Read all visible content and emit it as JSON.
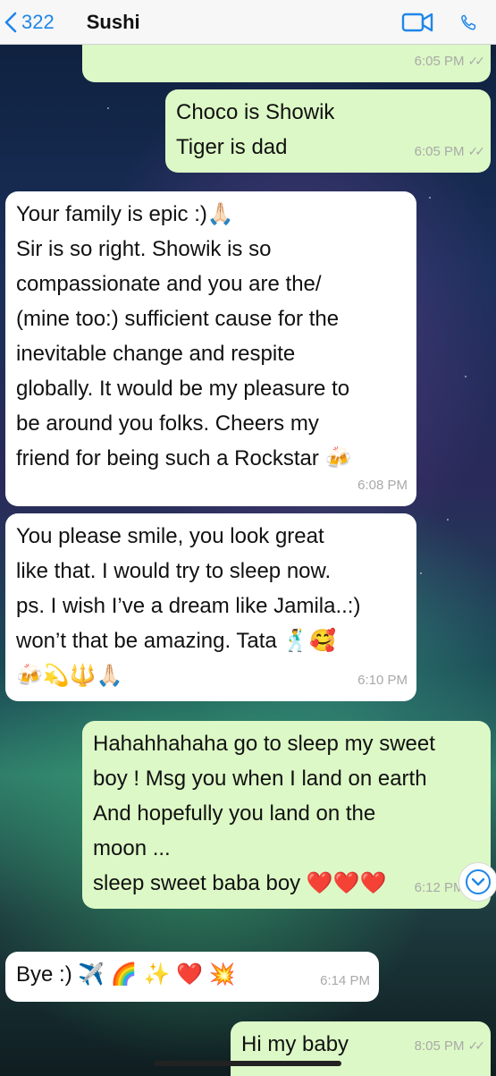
{
  "header": {
    "back_count": "322",
    "contact_name": "Sushi"
  },
  "messages": [
    {
      "dir": "out",
      "lines": [],
      "time": "6:05 PM"
    },
    {
      "dir": "out",
      "lines": [
        "Choco is Showik",
        "Tiger is dad"
      ],
      "time": "6:05 PM"
    },
    {
      "dir": "in",
      "lines": [
        "Your family is epic :)🙏🏻",
        "Sir is so right. Showik is so",
        "compassionate and you are the/",
        "(mine too:) sufficient cause for the",
        "inevitable change and respite",
        "globally. It would be my pleasure to",
        "be around you folks. Cheers my",
        "friend for being such a Rockstar 🍻"
      ],
      "time": "6:08 PM"
    },
    {
      "dir": "in",
      "lines": [
        "You please smile, you look great",
        "like that. I would try to sleep now.",
        "ps. I wish I’ve a dream like Jamila..:)",
        "won’t that be amazing. Tata 🕺🥰",
        "🍻💫🔱🙏🏻"
      ],
      "time": "6:10 PM"
    },
    {
      "dir": "out",
      "lines": [
        "Hahahhahaha go to sleep my sweet",
        "boy ! Msg you when I land on earth",
        "And hopefully you land on the",
        "moon ...",
        "sleep sweet baba boy ❤️❤️❤️"
      ],
      "time": "6:12 PM"
    },
    {
      "dir": "in",
      "lines": [
        "Bye :) ✈️ 🌈 ✨ ❤️ 💥"
      ],
      "time": "6:14 PM"
    },
    {
      "dir": "out",
      "lines": [
        "Hi my baby"
      ],
      "time": "8:05 PM"
    }
  ],
  "icons": {
    "back": "chevron-left-icon",
    "video": "video-camera-icon",
    "call": "phone-icon",
    "scroll": "chevron-down-icon"
  },
  "colors": {
    "accent": "#1f86e8",
    "outgoing_bubble": "#dcf8c6",
    "incoming_bubble": "#ffffff",
    "timestamp": "#a9a9a9"
  }
}
